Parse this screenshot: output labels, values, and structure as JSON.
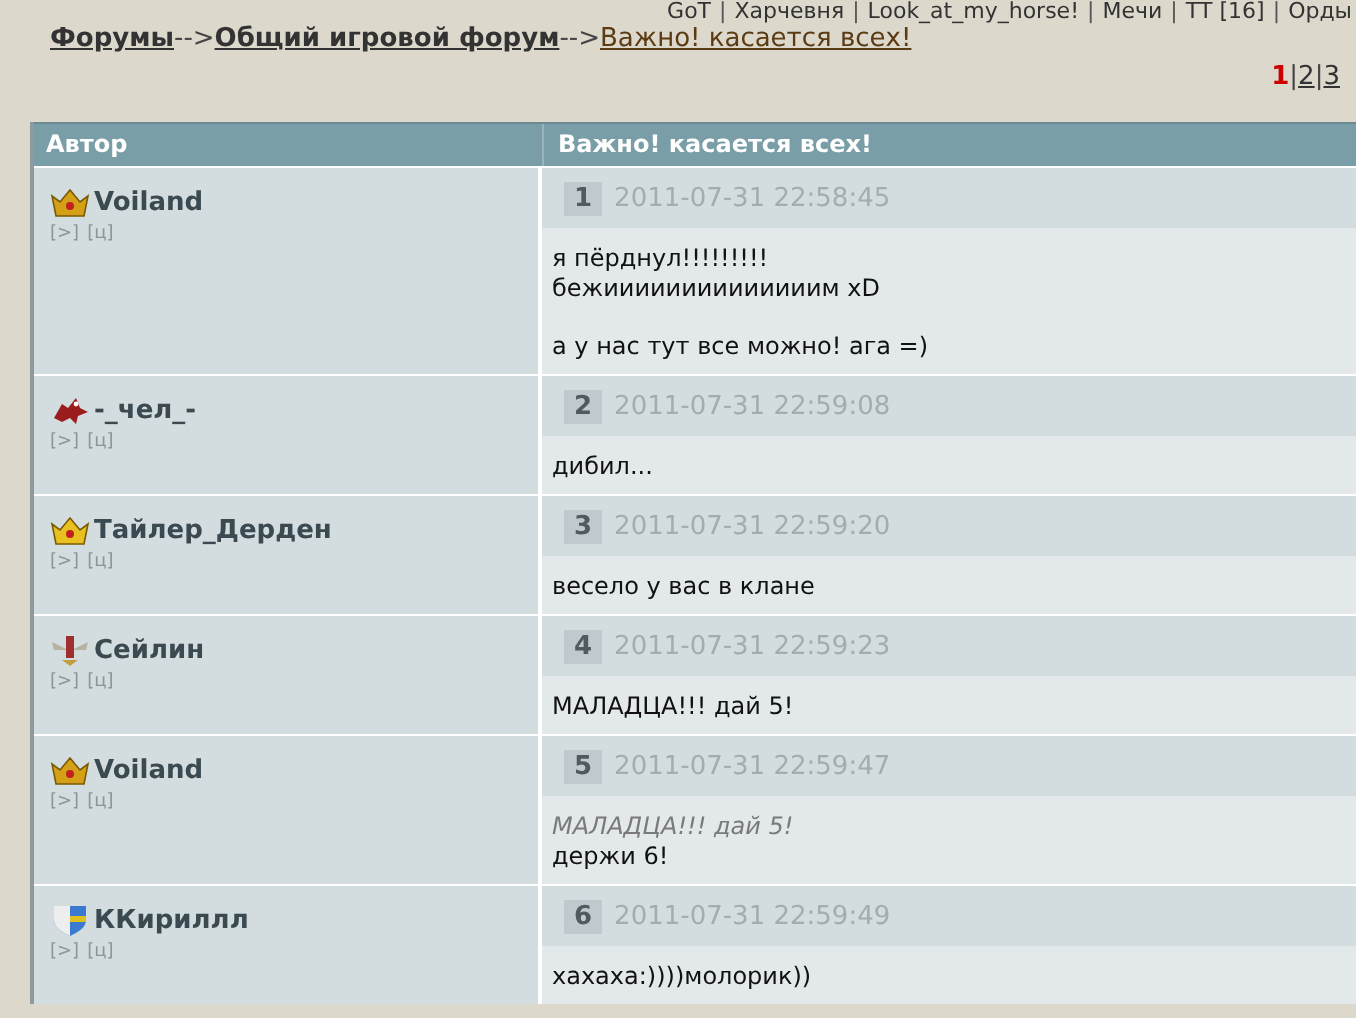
{
  "top_nav": [
    "GoT",
    "Харчевня",
    "Look_at_my_horse!",
    "Мечи",
    "ТТ [16]",
    "Орды"
  ],
  "breadcrumb": [
    {
      "label": "Форумы",
      "kind": "section"
    },
    {
      "label": "Общий игровой форум",
      "kind": "section"
    },
    {
      "label": "Важно! касается всех!",
      "kind": "current"
    }
  ],
  "nav_separator": "|",
  "breadcrumb_separator": "-->",
  "page_separator": "|",
  "pages": [
    {
      "label": "1",
      "selected": true
    },
    {
      "label": "2",
      "selected": false
    },
    {
      "label": "3",
      "selected": false
    }
  ],
  "table": {
    "columns": [
      "Автор",
      "Важно! касается всех!"
    ],
    "posts": [
      {
        "author": "Voiland",
        "kind": "crown",
        "color": "#d4a017",
        "links": [
          "[>]",
          "[ц]"
        ],
        "number": "1",
        "time": "2011-07-31 22:58:45",
        "blocks": [
          {
            "kind": "text",
            "text": "я пёрднул!!!!!!!!!\nбежиииииииииииииим xD"
          },
          {
            "kind": "text",
            "text": "а у нас тут все можно! ага =)"
          }
        ]
      },
      {
        "author": "-_чел_-",
        "kind": "beast",
        "color": "#9a1c1c",
        "links": [
          "[>]",
          "[ц]"
        ],
        "number": "2",
        "time": "2011-07-31 22:59:08",
        "blocks": [
          {
            "kind": "text",
            "text": "дибил..."
          }
        ]
      },
      {
        "author": "Тайлер_Дерден",
        "kind": "crown",
        "color": "#e8c020",
        "links": [
          "[>]",
          "[ц]"
        ],
        "number": "3",
        "time": "2011-07-31 22:59:20",
        "blocks": [
          {
            "kind": "text",
            "text": "весело у вас в клане"
          }
        ]
      },
      {
        "author": "Сейлин",
        "kind": "wings",
        "color": "#a03030",
        "links": [
          "[>]",
          "[ц]"
        ],
        "number": "4",
        "time": "2011-07-31 22:59:23",
        "blocks": [
          {
            "kind": "text",
            "text": "МАЛАДЦА!!! дай 5!"
          }
        ]
      },
      {
        "author": "Voiland",
        "kind": "crown",
        "color": "#d4a017",
        "links": [
          "[>]",
          "[ц]"
        ],
        "number": "5",
        "time": "2011-07-31 22:59:47",
        "blocks": [
          {
            "kind": "quote",
            "text": "МАЛАДЦА!!! дай 5!"
          },
          {
            "kind": "reply",
            "text": "держи 6!"
          }
        ]
      },
      {
        "author": "ККириллл",
        "kind": "shield",
        "color": "#3a7ad0",
        "links": [
          "[>]",
          "[ц]"
        ],
        "number": "6",
        "time": "2011-07-31 22:59:49",
        "blocks": [
          {
            "kind": "text",
            "text": "хахаха:))))молорик))"
          }
        ]
      }
    ]
  }
}
